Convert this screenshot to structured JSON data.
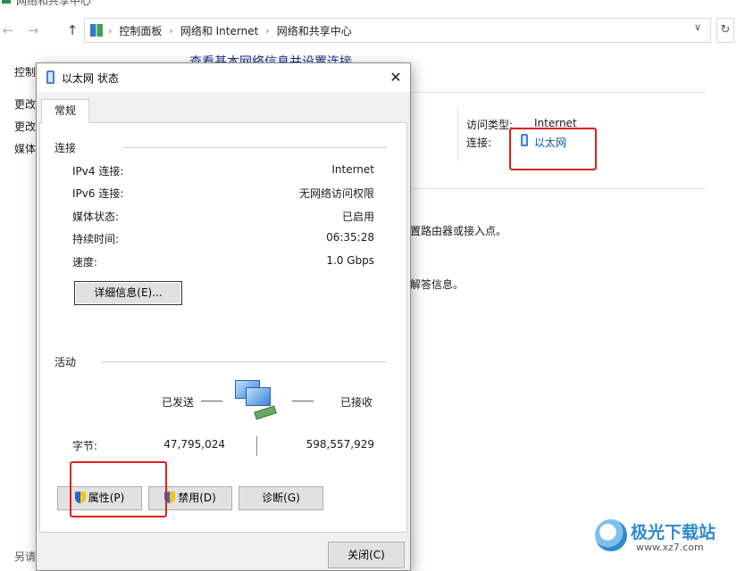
{
  "explorer": {
    "window_title": "网络和共享中心",
    "nav": {
      "back_icon": "arrow-left-icon",
      "forward_icon": "arrow-right-icon",
      "up_icon": "arrow-up-icon"
    },
    "breadcrumbs": [
      "控制面板",
      "网络和 Internet",
      "网络和共享中心"
    ],
    "left_pane": {
      "home": "控制",
      "items": [
        "更改",
        "更改",
        "媒体"
      ],
      "bottom": "另请"
    },
    "main_heading": "查看基本网络信息并设置连接",
    "access_type_label": "访问类型:",
    "access_type_value": "Internet",
    "connection_label": "连接:",
    "connection_value": "以太网",
    "line1": "置路由器或接入点。",
    "line2": "解答信息。"
  },
  "dialog": {
    "title": "以太网 状态",
    "tab": "常规",
    "connection_group": "连接",
    "rows": [
      {
        "label": "IPv4 连接:",
        "value": "Internet"
      },
      {
        "label": "IPv6 连接:",
        "value": "无网络访问权限"
      },
      {
        "label": "媒体状态:",
        "value": "已启用"
      },
      {
        "label": "持续时间:",
        "value": "06:35:28"
      },
      {
        "label": "速度:",
        "value": "1.0 Gbps"
      }
    ],
    "details_button": "详细信息(E)...",
    "activity_group": "活动",
    "sent_label": "已发送",
    "received_label": "已接收",
    "bytes_label": "字节:",
    "bytes_sent": "47,795,024",
    "bytes_received": "598,557,929",
    "buttons": {
      "properties": "属性(P)",
      "disable": "禁用(D)",
      "diagnose": "诊断(G)",
      "close": "关闭(C)"
    }
  },
  "watermark": {
    "title": "极光下载站",
    "url": "www.xz7.com"
  },
  "colors": {
    "highlight_box": "#e02020",
    "link": "#0b54b5",
    "heading": "#1e3287"
  }
}
